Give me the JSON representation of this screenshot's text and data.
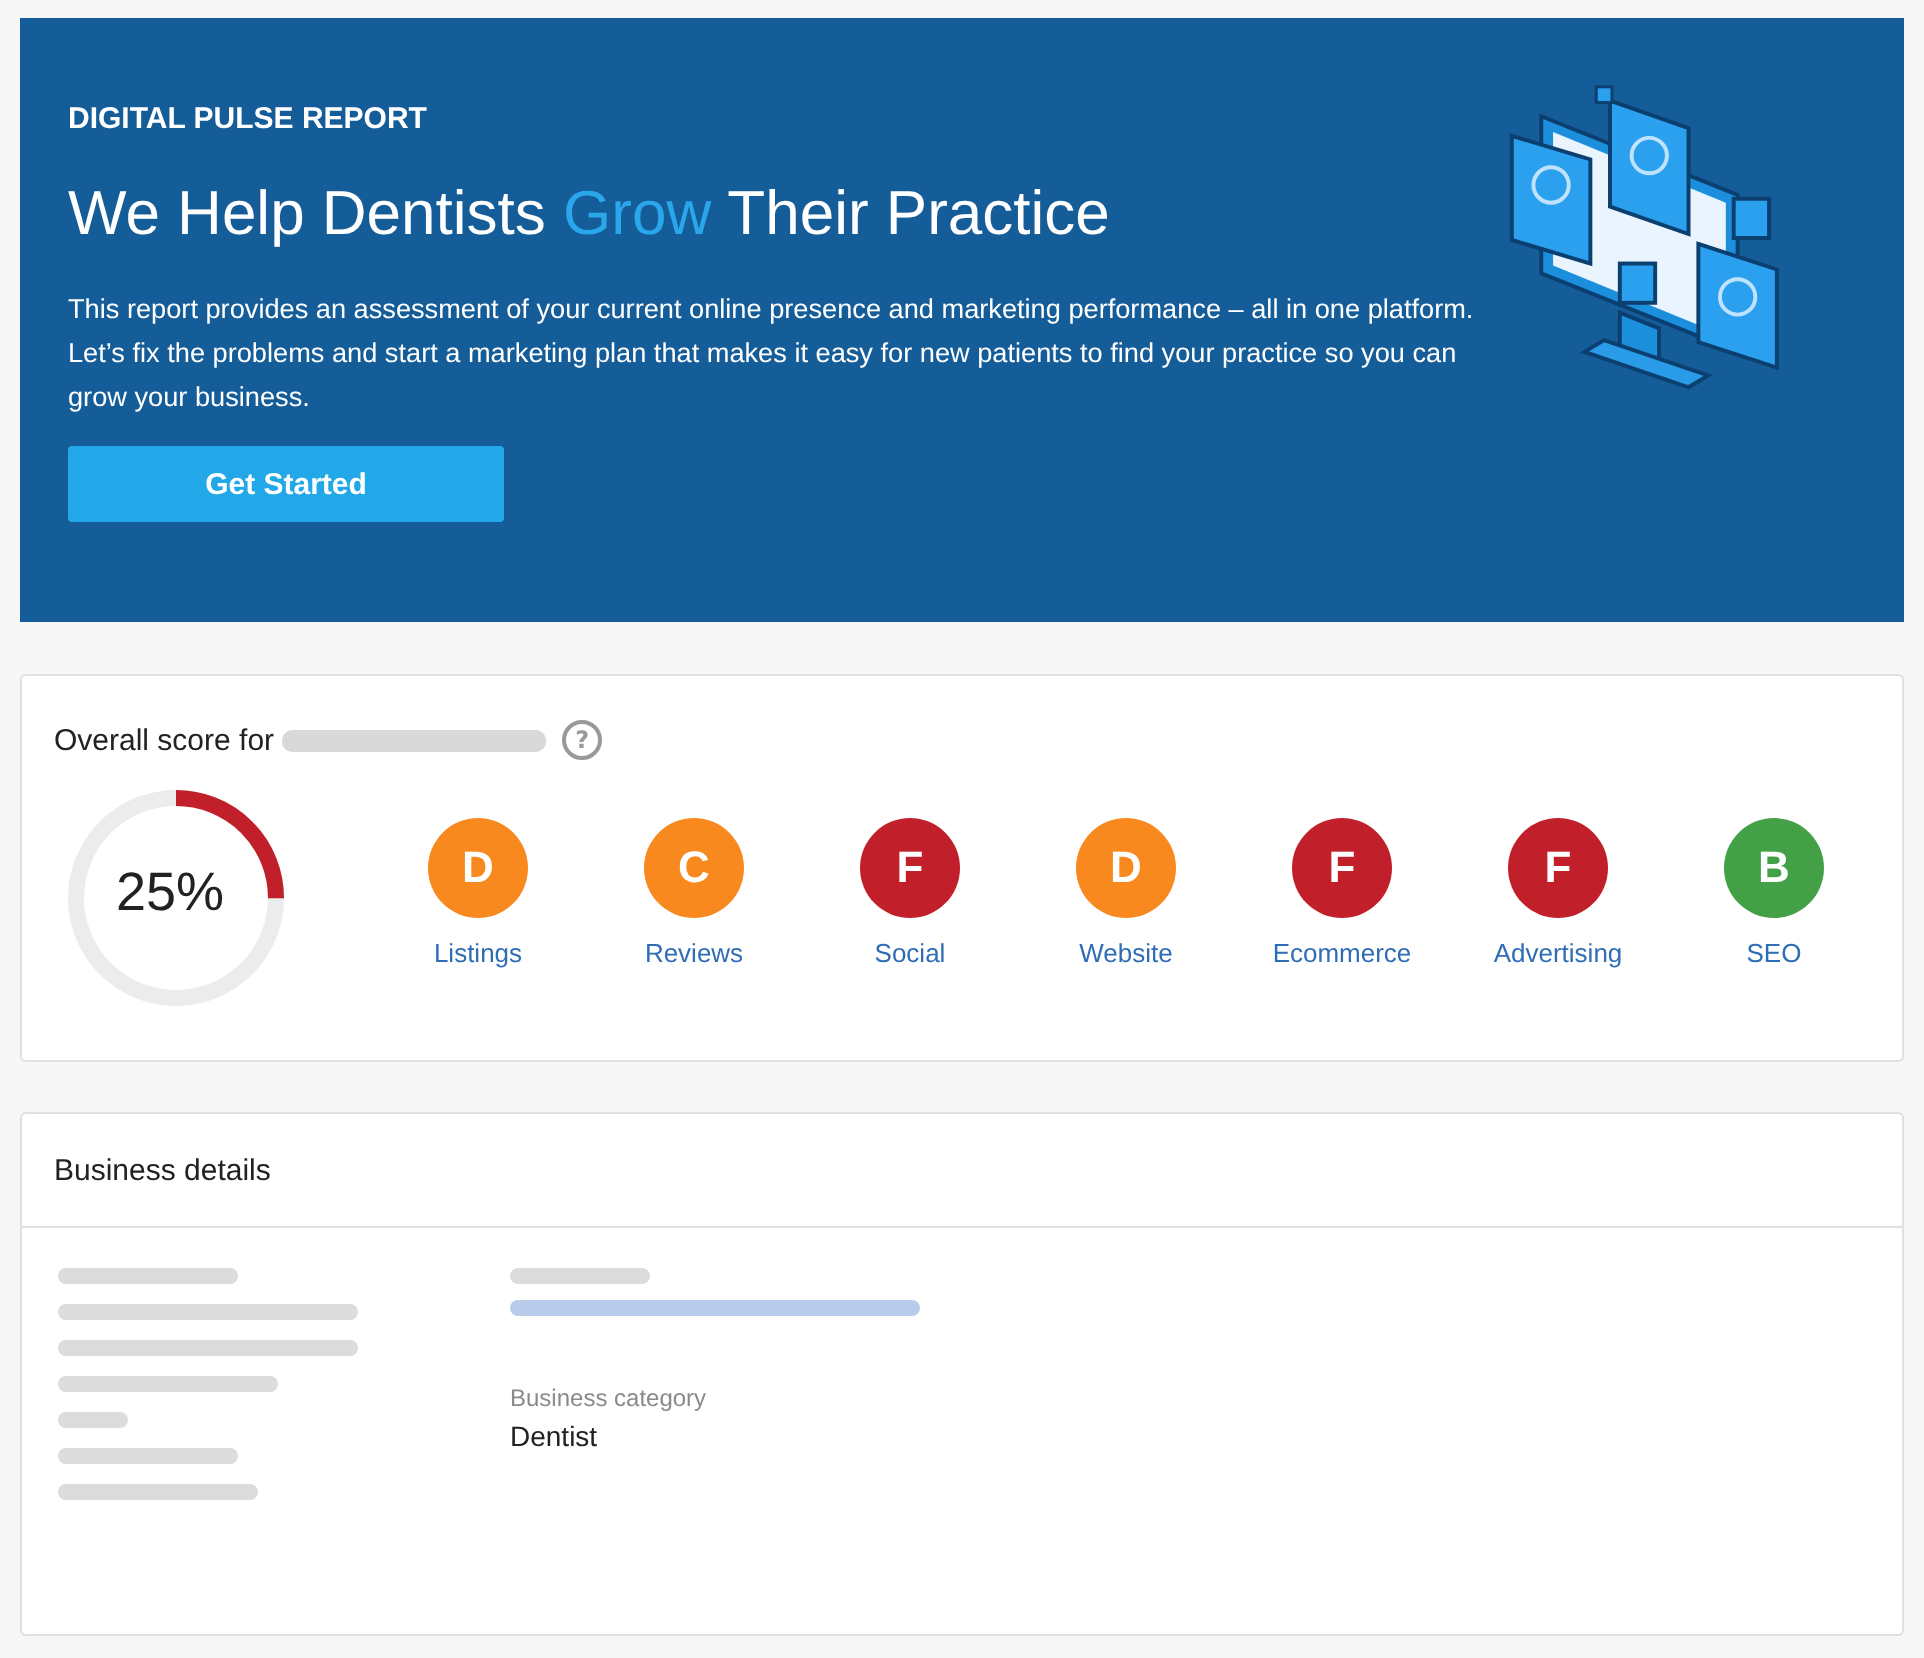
{
  "hero": {
    "eyebrow": "DIGITAL PULSE REPORT",
    "headline": [
      {
        "text": "We Help Dentists ",
        "highlight": false
      },
      {
        "text": "Grow",
        "highlight": true
      },
      {
        "text": " Their Practice",
        "highlight": false
      }
    ],
    "description": "This report provides an assessment of your current online presence and marketing performance – all in one platform. Let’s fix the problems and start a marketing plan that makes it easy for new patients to find your practice so you can grow your business.",
    "button": "Get Started"
  },
  "overall": {
    "title": "Overall score for",
    "help_icon": "?",
    "score": {
      "text": "25%",
      "level": 0.25
    },
    "grades": [
      {
        "grade": "D",
        "label": "Listings",
        "color": "#f7891f"
      },
      {
        "grade": "C",
        "label": "Reviews",
        "color": "#f7891f"
      },
      {
        "grade": "F",
        "label": "Social",
        "color": "#c1202b"
      },
      {
        "grade": "D",
        "label": "Website",
        "color": "#f7891f"
      },
      {
        "grade": "F",
        "label": "Ecommerce",
        "color": "#c1202b"
      },
      {
        "grade": "F",
        "label": "Advertising",
        "color": "#c1202b"
      },
      {
        "grade": "B",
        "label": "SEO",
        "color": "#43a047"
      }
    ]
  },
  "business_details": {
    "title": "Business details",
    "fields": [
      {
        "label": "Business category",
        "value": "Dentist"
      }
    ]
  }
}
